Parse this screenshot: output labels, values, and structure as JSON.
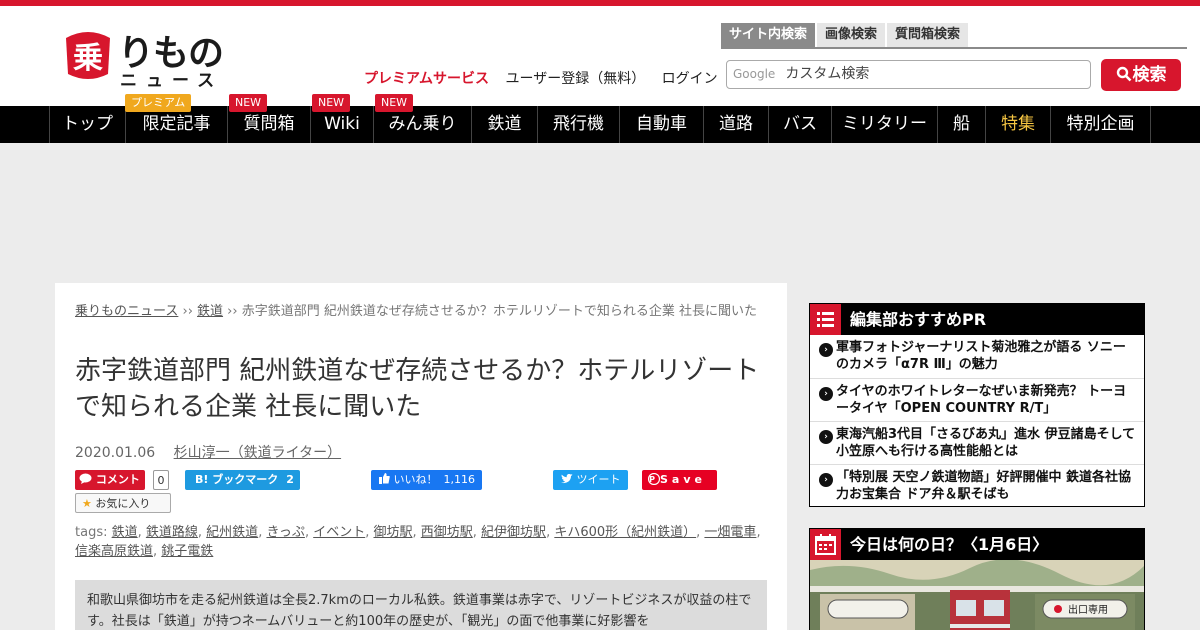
{
  "header": {
    "logo": {
      "main": "りもの",
      "sub": "ニュース",
      "badge_char": "乗"
    },
    "links": {
      "premium": "プレミアムサービス",
      "register": "ユーザー登録（無料）",
      "login": "ログイン"
    },
    "search": {
      "tabs": [
        "サイト内検索",
        "画像検索",
        "質問箱検索"
      ],
      "google_label": "Google",
      "placeholder": "カスタム検索",
      "button_label": "検索"
    }
  },
  "nav": {
    "items": [
      {
        "label": "トップ",
        "badge": ""
      },
      {
        "label": "限定記事",
        "badge": "プレミアム"
      },
      {
        "label": "質問箱",
        "badge": "NEW"
      },
      {
        "label": "Wiki",
        "badge": "NEW"
      },
      {
        "label": "みん乗り",
        "badge": "NEW"
      },
      {
        "label": "鉄道",
        "badge": ""
      },
      {
        "label": "飛行機",
        "badge": ""
      },
      {
        "label": "自動車",
        "badge": ""
      },
      {
        "label": "道路",
        "badge": ""
      },
      {
        "label": "バス",
        "badge": ""
      },
      {
        "label": "ミリタリー",
        "badge": ""
      },
      {
        "label": "船",
        "badge": ""
      },
      {
        "label": "特集",
        "badge": ""
      },
      {
        "label": "特別企画",
        "badge": ""
      }
    ]
  },
  "article": {
    "breadcrumb": {
      "home": "乗りものニュース",
      "sep1": " ›› ",
      "category": "鉄道",
      "sep2": " ›› ",
      "current": "赤字鉄道部門 紀州鉄道なぜ存続させるか？ホテルリゾートで知られる企業 社長に聞いた"
    },
    "title": "赤字鉄道部門 紀州鉄道なぜ存続させるか？ホテルリゾートで知られる企業 社長に聞いた",
    "date": "2020.01.06",
    "author": "杉山淳一（鉄道ライター）",
    "share": {
      "comment": "コメント",
      "comment_count": "0",
      "hatena": "B! ブックマーク",
      "hatena_count": "2",
      "like": "いいね！",
      "like_count": "1,116",
      "tweet": "ツイート",
      "save": "Save",
      "favorite": "お気に入り"
    },
    "tags_label": "tags:",
    "tags": [
      "鉄道",
      "鉄道路線",
      "紀州鉄道",
      "きっぷ",
      "イベント",
      "御坊駅",
      "西御坊駅",
      "紀伊御坊駅",
      "キハ600形（紀州鉄道）",
      "一畑電車",
      "信楽高原鉄道",
      "銚子電鉄"
    ],
    "lead": "和歌山県御坊市を走る紀州鉄道は全長2.7kmのローカル私鉄。鉄道事業は赤字で、リゾートビジネスが収益の柱です。社長は「鉄道」が持つネームバリューと約100年の歴史が、「観光」の面で他事業に好影響を"
  },
  "sidebar": {
    "pr": {
      "title": "編集部おすすめPR",
      "items": [
        "軍事フォトジャーナリスト菊池雅之が語る ソニーのカメラ「α7R Ⅲ」の魅力",
        "タイヤのホワイトレターなぜいま新発売？ トーヨータイヤ「OPEN COUNTRY R/T」",
        "東海汽船3代目「さるびあ丸」進水 伊豆諸島そして小笠原へも行ける高性能船とは",
        "「特別展 天空ノ鉄道物語」好評開催中 鉄道各社協力お宝集合 ドア弁＆駅そばも"
      ]
    },
    "today": {
      "title": "今日は何の日？〈1月6日〉",
      "sign_left": "",
      "sign_right": "出口専用"
    }
  },
  "colors": {
    "brand": "#d7162d",
    "nav_bg": "#000000",
    "special": "#f5c542"
  }
}
